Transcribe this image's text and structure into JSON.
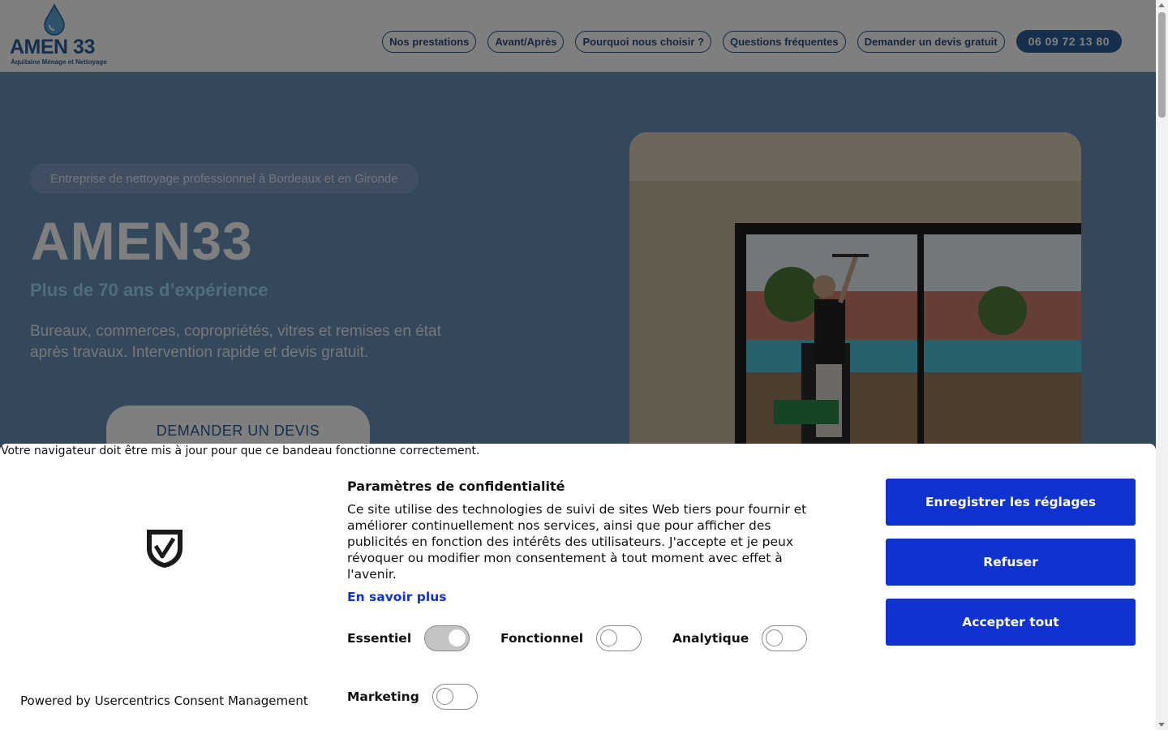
{
  "header": {
    "logo_text": "AMEN 33",
    "logo_subtitle": "Aquitaine Ménage et Nettoyage",
    "nav": [
      {
        "label": "Nos prestations"
      },
      {
        "label": "Avant/Après"
      },
      {
        "label": "Pourquoi nous choisir ?"
      },
      {
        "label": "Questions fréquentes"
      },
      {
        "label": "Demander un devis gratuit"
      }
    ],
    "phone": "06 09 72 13 80"
  },
  "hero": {
    "tag": "Entreprise de nettoyage professionnel à Bordeaux et en Gironde",
    "title": "AMEN33",
    "subtitle": "Plus de 70 ans d’expérience",
    "description": "Bureaux, commerces, copropriétés, vitres et remises en état après travaux. Intervention rapide et devis gratuit.",
    "cta": "DEMANDER UN DEVIS"
  },
  "consent": {
    "browser_warning": "Votre navigateur doit être mis à jour pour que ce bandeau fonctionne correctement.",
    "title": "Paramètres de confidentialité",
    "text": "Ce site utilise des technologies de suivi de sites Web tiers pour fournir et améliorer continuellement nos services, ainsi que pour afficher des publicités en fonction des intérêts des utilisateurs. J'accepte et je peux révoquer ou modifier mon consentement à tout moment avec effet à l'avenir.",
    "learn_more": "En savoir plus",
    "toggles": [
      {
        "label": "Essentiel",
        "state": "on"
      },
      {
        "label": "Fonctionnel",
        "state": "off"
      },
      {
        "label": "Analytique",
        "state": "off"
      },
      {
        "label": "Marketing",
        "state": "off"
      }
    ],
    "buttons": {
      "save": "Enregistrer les réglages",
      "refuse": "Refuser",
      "accept": "Accepter tout"
    },
    "powered_by": "Powered by Usercentrics Consent Management"
  },
  "colors": {
    "brand_blue": "#2a5e99",
    "consent_button": "#1032cf",
    "consent_link": "#1032cf"
  }
}
